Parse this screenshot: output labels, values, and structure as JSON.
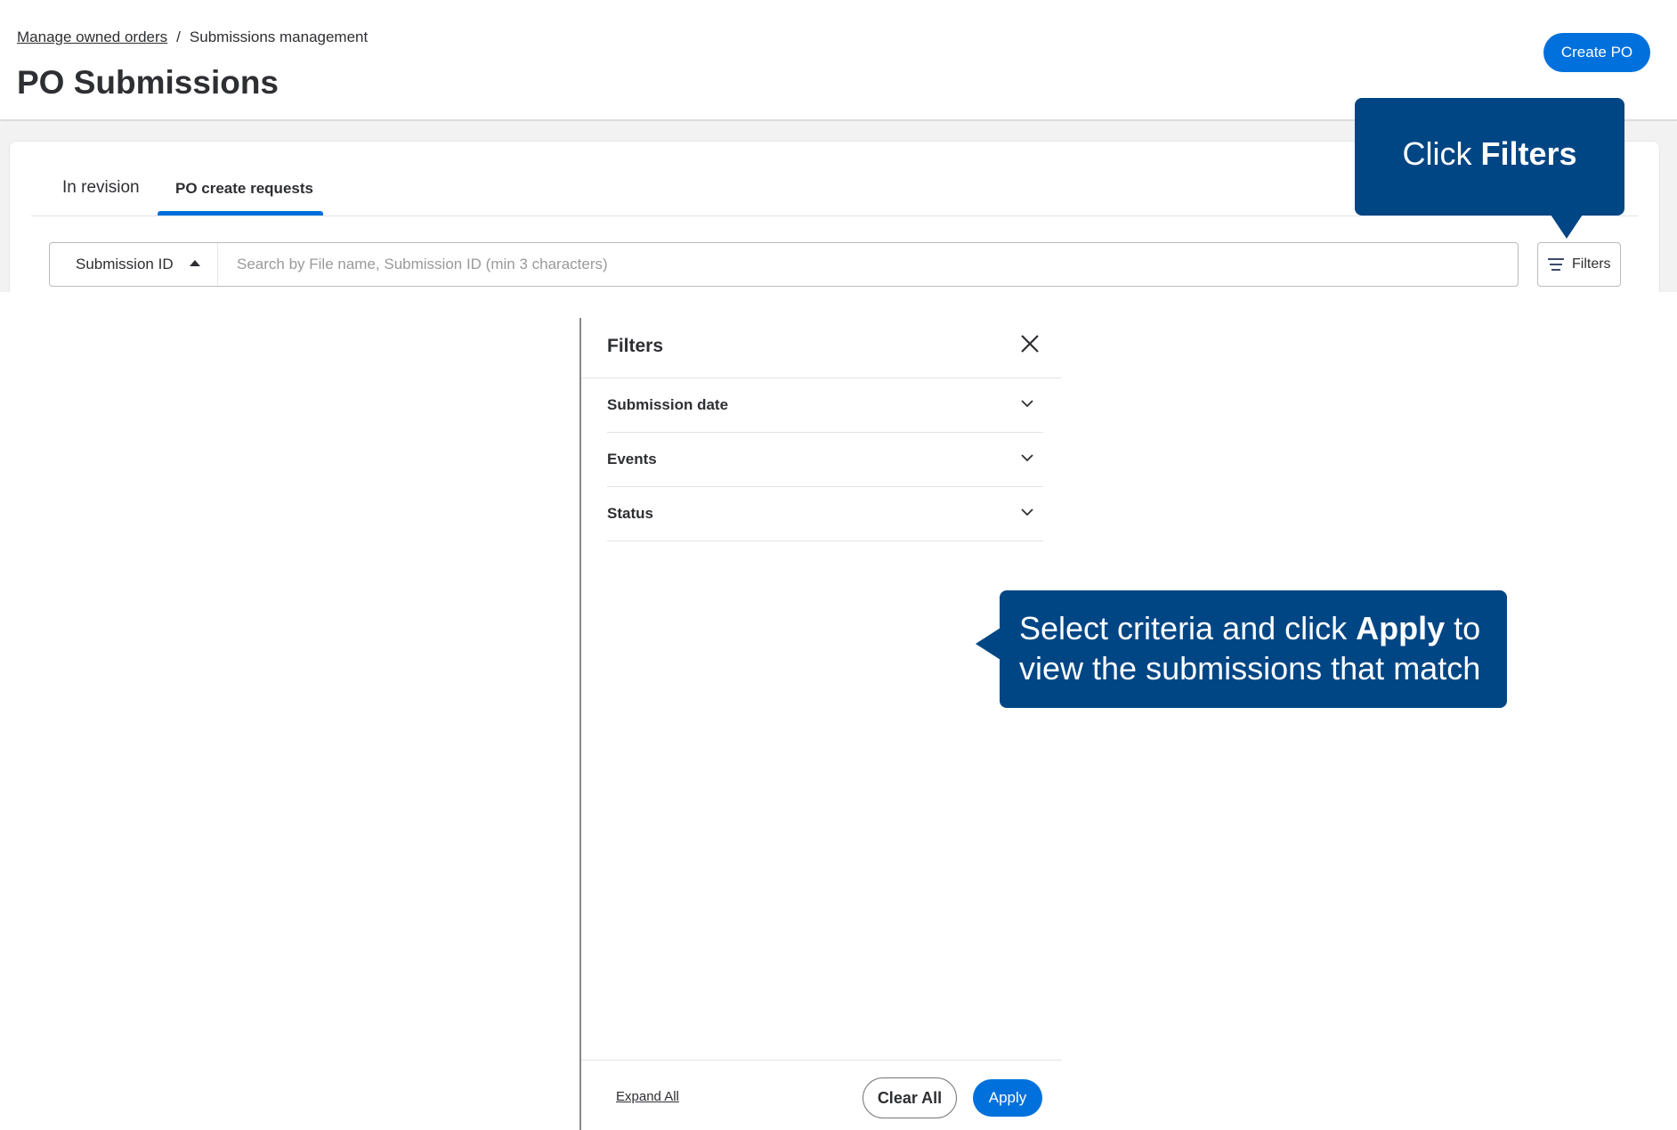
{
  "breadcrumb": {
    "parent": "Manage owned orders",
    "separator": "/",
    "current": "Submissions management"
  },
  "header": {
    "title": "PO Submissions",
    "create_label": "Create PO"
  },
  "tabs": [
    {
      "label": "In revision"
    },
    {
      "label": "PO create requests",
      "active": true
    }
  ],
  "search": {
    "field_select": "Submission ID",
    "placeholder": "Search by File name, Submission ID (min 3 characters)",
    "value": "",
    "filters_label": "Filters"
  },
  "callouts": {
    "filters": {
      "prefix": "Click ",
      "bold": "Filters"
    },
    "apply": {
      "prefix": "Select criteria and click ",
      "bold": "Apply",
      "suffix": " to view the submissions that match"
    }
  },
  "panel": {
    "title": "Filters",
    "sections": [
      {
        "label": "Submission date"
      },
      {
        "label": "Events"
      },
      {
        "label": "Status"
      }
    ],
    "expand_all": "Expand All",
    "clear_all": "Clear All",
    "apply": "Apply"
  },
  "colors": {
    "accent": "#0071dc",
    "callout": "#004684"
  }
}
